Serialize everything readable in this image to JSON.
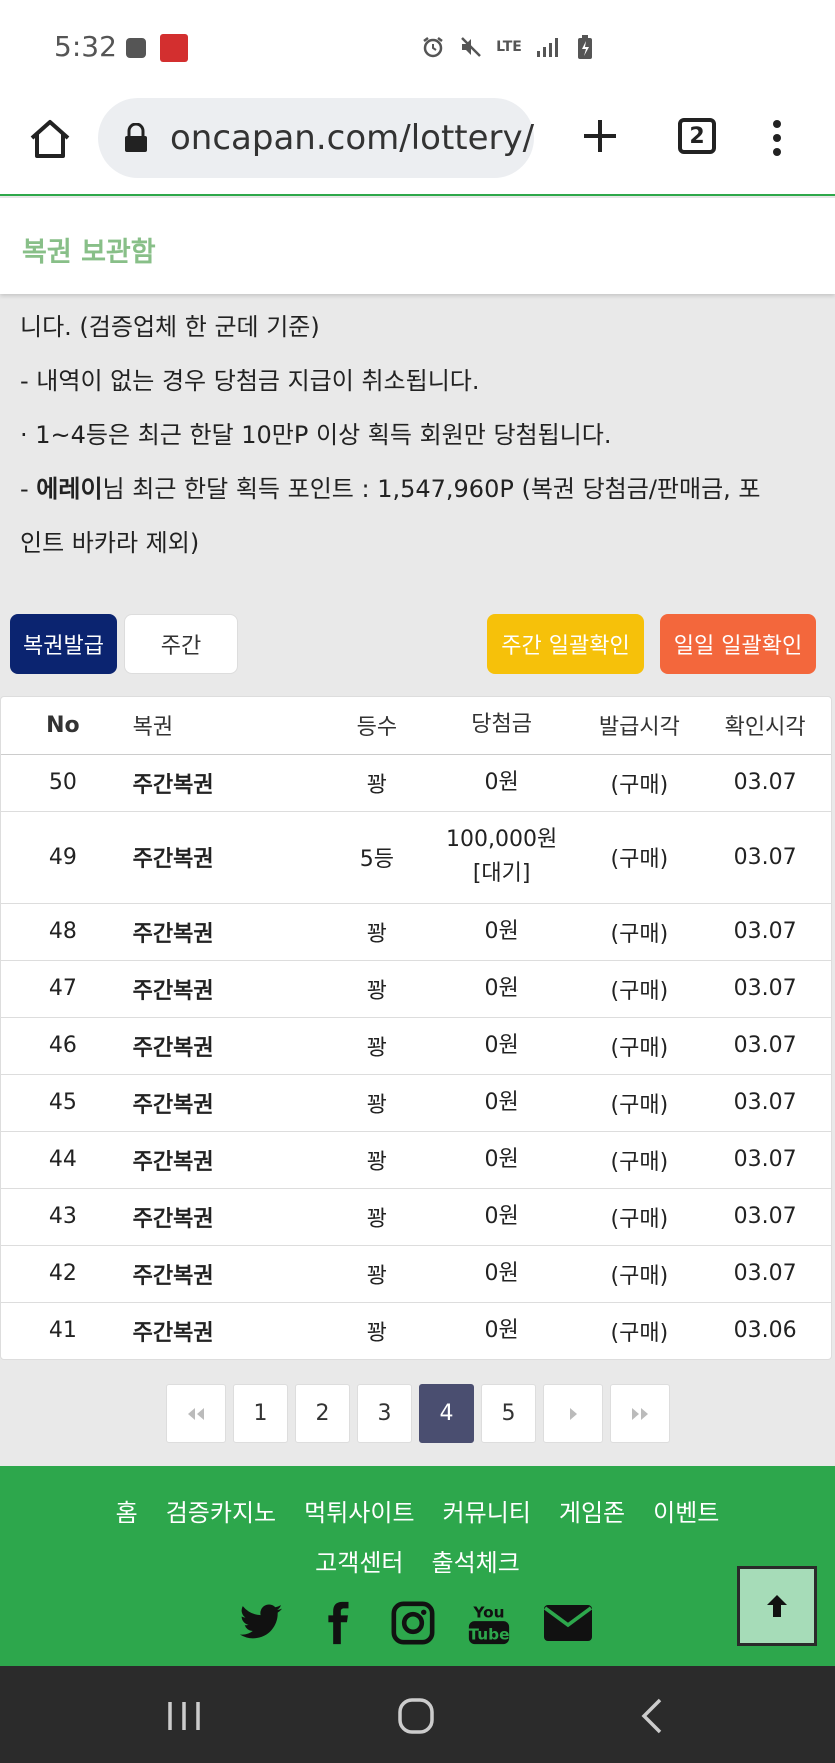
{
  "status_bar": {
    "time": "5:32",
    "lte": "LTE"
  },
  "browser": {
    "url": "oncapan.com/lottery/",
    "tab_count": "2"
  },
  "section": {
    "title": "복권 보관함"
  },
  "notice": {
    "line1": "니다. (검증업체 한 군데 기준)",
    "line2": " - 내역이 없는 경우 당첨금 지급이 취소됩니다.",
    "line3": "· 1~4등은 최근 한달 10만P 이상 획득 회원만 당첨됩니다.",
    "line4_prefix": " - ",
    "line4_user": "에레이",
    "line4_rest": "님 최근 한달 획득 포인트 : 1,547,960P (복권 당첨금/판매금, 포",
    "line5": "인트 바카라 제외)"
  },
  "buttons": {
    "issue": "복권발급",
    "weekly": "주간",
    "weekly_check": "주간 일괄확인",
    "daily_check": "일일 일괄확인"
  },
  "table": {
    "headers": {
      "no": "No",
      "name": "복권",
      "rank": "등수",
      "prize": "당첨금",
      "issued": "발급시각",
      "checked": "확인시각"
    },
    "rows": [
      {
        "no": "50",
        "name": "주간복권",
        "rank": "꽝",
        "prize": "0원",
        "prize2": "",
        "issued": "(구매)",
        "checked": "03.07"
      },
      {
        "no": "49",
        "name": "주간복권",
        "rank": "5등",
        "prize": "100,000원",
        "prize2": "[대기]",
        "issued": "(구매)",
        "checked": "03.07"
      },
      {
        "no": "48",
        "name": "주간복권",
        "rank": "꽝",
        "prize": "0원",
        "prize2": "",
        "issued": "(구매)",
        "checked": "03.07"
      },
      {
        "no": "47",
        "name": "주간복권",
        "rank": "꽝",
        "prize": "0원",
        "prize2": "",
        "issued": "(구매)",
        "checked": "03.07"
      },
      {
        "no": "46",
        "name": "주간복권",
        "rank": "꽝",
        "prize": "0원",
        "prize2": "",
        "issued": "(구매)",
        "checked": "03.07"
      },
      {
        "no": "45",
        "name": "주간복권",
        "rank": "꽝",
        "prize": "0원",
        "prize2": "",
        "issued": "(구매)",
        "checked": "03.07"
      },
      {
        "no": "44",
        "name": "주간복권",
        "rank": "꽝",
        "prize": "0원",
        "prize2": "",
        "issued": "(구매)",
        "checked": "03.07"
      },
      {
        "no": "43",
        "name": "주간복권",
        "rank": "꽝",
        "prize": "0원",
        "prize2": "",
        "issued": "(구매)",
        "checked": "03.07"
      },
      {
        "no": "42",
        "name": "주간복권",
        "rank": "꽝",
        "prize": "0원",
        "prize2": "",
        "issued": "(구매)",
        "checked": "03.07"
      },
      {
        "no": "41",
        "name": "주간복권",
        "rank": "꽝",
        "prize": "0원",
        "prize2": "",
        "issued": "(구매)",
        "checked": "03.06"
      }
    ]
  },
  "pagination": {
    "pages": [
      "1",
      "2",
      "3",
      "4",
      "5"
    ],
    "current": "4"
  },
  "footer": {
    "nav": [
      "홈",
      "검증카지노",
      "먹튀사이트",
      "커뮤니티",
      "게임존",
      "이벤트",
      "고객센터",
      "출석체크"
    ],
    "social_icons": [
      "twitter-icon",
      "facebook-icon",
      "instagram-icon",
      "youtube-icon",
      "email-icon"
    ]
  },
  "colors": {
    "accent_green": "#2da74c",
    "issue_button": "#0b2470",
    "weekly_check_button": "#f6c10a",
    "daily_check_button": "#f3673c",
    "active_page": "#4a4e70"
  }
}
